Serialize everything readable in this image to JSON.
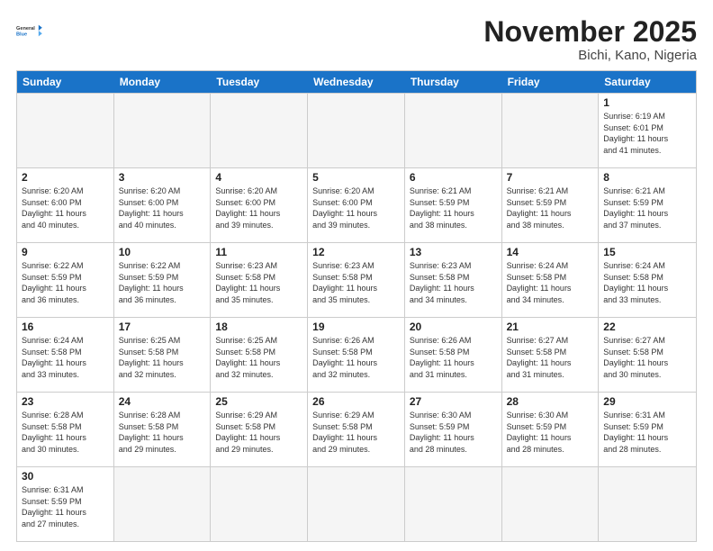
{
  "logo": {
    "general": "General",
    "blue": "Blue"
  },
  "title": "November 2025",
  "location": "Bichi, Kano, Nigeria",
  "weekdays": [
    "Sunday",
    "Monday",
    "Tuesday",
    "Wednesday",
    "Thursday",
    "Friday",
    "Saturday"
  ],
  "rows": [
    [
      {
        "day": "",
        "info": ""
      },
      {
        "day": "",
        "info": ""
      },
      {
        "day": "",
        "info": ""
      },
      {
        "day": "",
        "info": ""
      },
      {
        "day": "",
        "info": ""
      },
      {
        "day": "",
        "info": ""
      },
      {
        "day": "1",
        "info": "Sunrise: 6:19 AM\nSunset: 6:01 PM\nDaylight: 11 hours\nand 41 minutes."
      }
    ],
    [
      {
        "day": "2",
        "info": "Sunrise: 6:20 AM\nSunset: 6:00 PM\nDaylight: 11 hours\nand 40 minutes."
      },
      {
        "day": "3",
        "info": "Sunrise: 6:20 AM\nSunset: 6:00 PM\nDaylight: 11 hours\nand 40 minutes."
      },
      {
        "day": "4",
        "info": "Sunrise: 6:20 AM\nSunset: 6:00 PM\nDaylight: 11 hours\nand 39 minutes."
      },
      {
        "day": "5",
        "info": "Sunrise: 6:20 AM\nSunset: 6:00 PM\nDaylight: 11 hours\nand 39 minutes."
      },
      {
        "day": "6",
        "info": "Sunrise: 6:21 AM\nSunset: 5:59 PM\nDaylight: 11 hours\nand 38 minutes."
      },
      {
        "day": "7",
        "info": "Sunrise: 6:21 AM\nSunset: 5:59 PM\nDaylight: 11 hours\nand 38 minutes."
      },
      {
        "day": "8",
        "info": "Sunrise: 6:21 AM\nSunset: 5:59 PM\nDaylight: 11 hours\nand 37 minutes."
      }
    ],
    [
      {
        "day": "9",
        "info": "Sunrise: 6:22 AM\nSunset: 5:59 PM\nDaylight: 11 hours\nand 36 minutes."
      },
      {
        "day": "10",
        "info": "Sunrise: 6:22 AM\nSunset: 5:59 PM\nDaylight: 11 hours\nand 36 minutes."
      },
      {
        "day": "11",
        "info": "Sunrise: 6:23 AM\nSunset: 5:58 PM\nDaylight: 11 hours\nand 35 minutes."
      },
      {
        "day": "12",
        "info": "Sunrise: 6:23 AM\nSunset: 5:58 PM\nDaylight: 11 hours\nand 35 minutes."
      },
      {
        "day": "13",
        "info": "Sunrise: 6:23 AM\nSunset: 5:58 PM\nDaylight: 11 hours\nand 34 minutes."
      },
      {
        "day": "14",
        "info": "Sunrise: 6:24 AM\nSunset: 5:58 PM\nDaylight: 11 hours\nand 34 minutes."
      },
      {
        "day": "15",
        "info": "Sunrise: 6:24 AM\nSunset: 5:58 PM\nDaylight: 11 hours\nand 33 minutes."
      }
    ],
    [
      {
        "day": "16",
        "info": "Sunrise: 6:24 AM\nSunset: 5:58 PM\nDaylight: 11 hours\nand 33 minutes."
      },
      {
        "day": "17",
        "info": "Sunrise: 6:25 AM\nSunset: 5:58 PM\nDaylight: 11 hours\nand 32 minutes."
      },
      {
        "day": "18",
        "info": "Sunrise: 6:25 AM\nSunset: 5:58 PM\nDaylight: 11 hours\nand 32 minutes."
      },
      {
        "day": "19",
        "info": "Sunrise: 6:26 AM\nSunset: 5:58 PM\nDaylight: 11 hours\nand 32 minutes."
      },
      {
        "day": "20",
        "info": "Sunrise: 6:26 AM\nSunset: 5:58 PM\nDaylight: 11 hours\nand 31 minutes."
      },
      {
        "day": "21",
        "info": "Sunrise: 6:27 AM\nSunset: 5:58 PM\nDaylight: 11 hours\nand 31 minutes."
      },
      {
        "day": "22",
        "info": "Sunrise: 6:27 AM\nSunset: 5:58 PM\nDaylight: 11 hours\nand 30 minutes."
      }
    ],
    [
      {
        "day": "23",
        "info": "Sunrise: 6:28 AM\nSunset: 5:58 PM\nDaylight: 11 hours\nand 30 minutes."
      },
      {
        "day": "24",
        "info": "Sunrise: 6:28 AM\nSunset: 5:58 PM\nDaylight: 11 hours\nand 29 minutes."
      },
      {
        "day": "25",
        "info": "Sunrise: 6:29 AM\nSunset: 5:58 PM\nDaylight: 11 hours\nand 29 minutes."
      },
      {
        "day": "26",
        "info": "Sunrise: 6:29 AM\nSunset: 5:58 PM\nDaylight: 11 hours\nand 29 minutes."
      },
      {
        "day": "27",
        "info": "Sunrise: 6:30 AM\nSunset: 5:59 PM\nDaylight: 11 hours\nand 28 minutes."
      },
      {
        "day": "28",
        "info": "Sunrise: 6:30 AM\nSunset: 5:59 PM\nDaylight: 11 hours\nand 28 minutes."
      },
      {
        "day": "29",
        "info": "Sunrise: 6:31 AM\nSunset: 5:59 PM\nDaylight: 11 hours\nand 28 minutes."
      }
    ],
    [
      {
        "day": "30",
        "info": "Sunrise: 6:31 AM\nSunset: 5:59 PM\nDaylight: 11 hours\nand 27 minutes."
      },
      {
        "day": "",
        "info": ""
      },
      {
        "day": "",
        "info": ""
      },
      {
        "day": "",
        "info": ""
      },
      {
        "day": "",
        "info": ""
      },
      {
        "day": "",
        "info": ""
      },
      {
        "day": "",
        "info": ""
      }
    ]
  ]
}
